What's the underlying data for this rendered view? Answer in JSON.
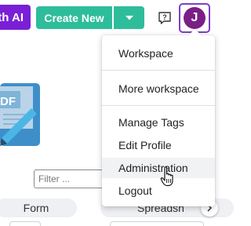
{
  "header": {
    "ai_button_label": "th AI",
    "create_button_label": "Create New",
    "avatar_initial": "J",
    "colors": {
      "ai": "#7a1fd6",
      "create": "#2ebd9b",
      "avatar": "#7a1f86",
      "avatar_border": "#7b3fc8"
    },
    "icons": {
      "create_caret": "chevron-down-icon",
      "help": "help-chat-icon"
    }
  },
  "main": {
    "filter_placeholder": "Filter ...",
    "tabs": [
      {
        "label": "Form"
      },
      {
        "label": "Spreadsh"
      }
    ],
    "icons": {
      "thumbnail": "pdf-document-icon",
      "scroll": "chevron-right-icon"
    }
  },
  "user_menu": {
    "items": [
      {
        "label": "Workspace"
      },
      {
        "label": "More workspace"
      },
      {
        "label": "Manage Tags"
      },
      {
        "label": "Edit Profile"
      },
      {
        "label": "Administration"
      },
      {
        "label": "Logout"
      }
    ]
  }
}
